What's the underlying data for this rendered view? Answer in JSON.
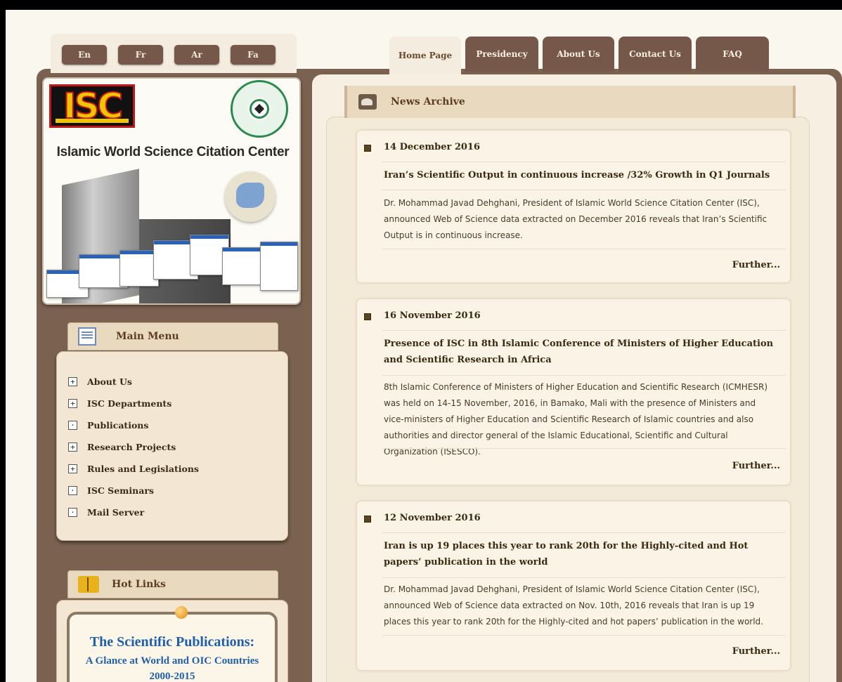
{
  "languages": [
    "En",
    "Fr",
    "Ar",
    "Fa"
  ],
  "tabs": [
    "Home Page",
    "Presidency",
    "About Us",
    "Contact Us",
    "FAQ"
  ],
  "banner": {
    "logo_text": "ISC",
    "title": "Islamic World Science Citation Center"
  },
  "main_menu": {
    "title": "Main Menu",
    "items": [
      {
        "label": "About Us",
        "expander": "+"
      },
      {
        "label": "ISC Departments",
        "expander": "+"
      },
      {
        "label": "Publications",
        "expander": "·"
      },
      {
        "label": "Research Projects",
        "expander": "+"
      },
      {
        "label": "Rules and Legislations",
        "expander": "+"
      },
      {
        "label": "ISC Seminars",
        "expander": "·"
      },
      {
        "label": "Mail Server",
        "expander": "·"
      }
    ]
  },
  "hot_links": {
    "title": "Hot Links",
    "ad_title": "The Scientific Publications:",
    "ad_subtitle": "A Glance at World and OIC Countries",
    "ad_years": "2000-2015"
  },
  "news": {
    "title": "News Archive",
    "further_label": "Further...",
    "items": [
      {
        "date": "14 December 2016",
        "title": "Iran’s Scientific Output in continuous increase /32% Growth in Q1 Journals",
        "body": "Dr. Mohammad Javad Dehghani, President of Islamic World Science Citation Center (ISC), announced Web of Science data extracted on December 2016 reveals that Iran’s Scientific Output is in continuous increase."
      },
      {
        "date": "16 November 2016",
        "title": "Presence of ISC in 8th Islamic Conference of Ministers of Higher Education and Scientific Research in Africa",
        "body": "8th Islamic Conference of Ministers of Higher Education and Scientific Research (ICMHESR) was held on 14-15 November, 2016, in Bamako, Mali with the presence of Ministers and vice-ministers of Higher Education and Scientific Research of Islamic countries and also authorities and director general of the Islamic Educational, Scientific and Cultural Organization (ISESCO)."
      },
      {
        "date": "12 November 2016",
        "title": "Iran is up 19 places this year to rank 20th for the Highly-cited and Hot papers’ publication in the world",
        "body": "Dr. Mohammad Javad Dehghani, President of Islamic World Science Citation Center (ISC), announced Web of Science data extracted on Nov. 10th, 2016 reveals that Iran is up 19 places this year to rank 20th for the Highly-cited and hot papers’ publication in the world."
      }
    ]
  }
}
